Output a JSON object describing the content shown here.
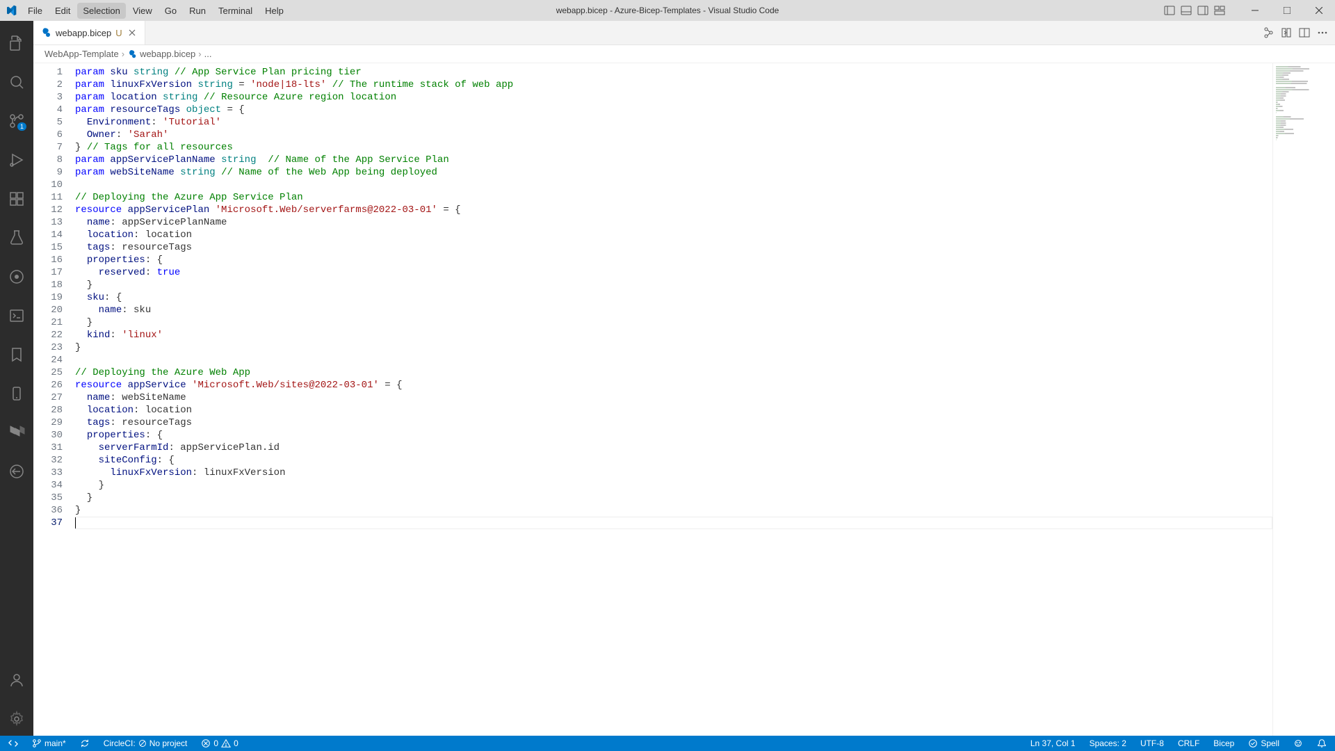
{
  "window": {
    "title": "webapp.bicep - Azure-Bicep-Templates - Visual Studio Code"
  },
  "menu": {
    "file": "File",
    "edit": "Edit",
    "selection": "Selection",
    "view": "View",
    "go": "Go",
    "run": "Run",
    "terminal": "Terminal",
    "help": "Help"
  },
  "activitybar": {
    "scm_badge": "1"
  },
  "tab": {
    "label": "webapp.bicep",
    "modified_marker": "U"
  },
  "breadcrumbs": {
    "root": "WebApp-Template",
    "file": "webapp.bicep",
    "trail": "..."
  },
  "code": {
    "lines": [
      {
        "n": 1,
        "tokens": [
          [
            "kw",
            "param"
          ],
          [
            "plain",
            " "
          ],
          [
            "ident",
            "sku"
          ],
          [
            "plain",
            " "
          ],
          [
            "type",
            "string"
          ],
          [
            "plain",
            " "
          ],
          [
            "com",
            "// App Service Plan pricing tier"
          ]
        ]
      },
      {
        "n": 2,
        "tokens": [
          [
            "kw",
            "param"
          ],
          [
            "plain",
            " "
          ],
          [
            "ident",
            "linuxFxVersion"
          ],
          [
            "plain",
            " "
          ],
          [
            "type",
            "string"
          ],
          [
            "plain",
            " = "
          ],
          [
            "str",
            "'node|18-lts'"
          ],
          [
            "plain",
            " "
          ],
          [
            "com",
            "// The runtime stack of web app"
          ]
        ]
      },
      {
        "n": 3,
        "tokens": [
          [
            "kw",
            "param"
          ],
          [
            "plain",
            " "
          ],
          [
            "ident",
            "location"
          ],
          [
            "plain",
            " "
          ],
          [
            "type",
            "string"
          ],
          [
            "plain",
            " "
          ],
          [
            "com",
            "// Resource Azure region location"
          ]
        ]
      },
      {
        "n": 4,
        "tokens": [
          [
            "kw",
            "param"
          ],
          [
            "plain",
            " "
          ],
          [
            "ident",
            "resourceTags"
          ],
          [
            "plain",
            " "
          ],
          [
            "type",
            "object"
          ],
          [
            "plain",
            " = {"
          ]
        ]
      },
      {
        "n": 5,
        "tokens": [
          [
            "plain",
            "  "
          ],
          [
            "prop",
            "Environment"
          ],
          [
            "plain",
            ": "
          ],
          [
            "str",
            "'Tutorial'"
          ]
        ]
      },
      {
        "n": 6,
        "tokens": [
          [
            "plain",
            "  "
          ],
          [
            "prop",
            "Owner"
          ],
          [
            "plain",
            ": "
          ],
          [
            "str",
            "'Sarah'"
          ]
        ]
      },
      {
        "n": 7,
        "tokens": [
          [
            "plain",
            "} "
          ],
          [
            "com",
            "// Tags for all resources"
          ]
        ]
      },
      {
        "n": 8,
        "tokens": [
          [
            "kw",
            "param"
          ],
          [
            "plain",
            " "
          ],
          [
            "ident",
            "appServicePlanName"
          ],
          [
            "plain",
            " "
          ],
          [
            "type",
            "string"
          ],
          [
            "plain",
            "  "
          ],
          [
            "com",
            "// Name of the App Service Plan"
          ]
        ]
      },
      {
        "n": 9,
        "tokens": [
          [
            "kw",
            "param"
          ],
          [
            "plain",
            " "
          ],
          [
            "ident",
            "webSiteName"
          ],
          [
            "plain",
            " "
          ],
          [
            "type",
            "string"
          ],
          [
            "plain",
            " "
          ],
          [
            "com",
            "// Name of the Web App being deployed"
          ]
        ]
      },
      {
        "n": 10,
        "tokens": [
          [
            "plain",
            ""
          ]
        ]
      },
      {
        "n": 11,
        "tokens": [
          [
            "com",
            "// Deploying the Azure App Service Plan"
          ]
        ]
      },
      {
        "n": 12,
        "tokens": [
          [
            "kw",
            "resource"
          ],
          [
            "plain",
            " "
          ],
          [
            "ident",
            "appServicePlan"
          ],
          [
            "plain",
            " "
          ],
          [
            "str",
            "'Microsoft.Web/serverfarms@2022-03-01'"
          ],
          [
            "plain",
            " = {"
          ]
        ]
      },
      {
        "n": 13,
        "tokens": [
          [
            "plain",
            "  "
          ],
          [
            "prop",
            "name"
          ],
          [
            "plain",
            ": appServicePlanName"
          ]
        ]
      },
      {
        "n": 14,
        "tokens": [
          [
            "plain",
            "  "
          ],
          [
            "prop",
            "location"
          ],
          [
            "plain",
            ": location"
          ]
        ]
      },
      {
        "n": 15,
        "tokens": [
          [
            "plain",
            "  "
          ],
          [
            "prop",
            "tags"
          ],
          [
            "plain",
            ": resourceTags"
          ]
        ]
      },
      {
        "n": 16,
        "tokens": [
          [
            "plain",
            "  "
          ],
          [
            "prop",
            "properties"
          ],
          [
            "plain",
            ": {"
          ]
        ]
      },
      {
        "n": 17,
        "tokens": [
          [
            "plain",
            "    "
          ],
          [
            "prop",
            "reserved"
          ],
          [
            "plain",
            ": "
          ],
          [
            "const",
            "true"
          ]
        ]
      },
      {
        "n": 18,
        "tokens": [
          [
            "plain",
            "  }"
          ]
        ]
      },
      {
        "n": 19,
        "tokens": [
          [
            "plain",
            "  "
          ],
          [
            "prop",
            "sku"
          ],
          [
            "plain",
            ": {"
          ]
        ]
      },
      {
        "n": 20,
        "tokens": [
          [
            "plain",
            "    "
          ],
          [
            "prop",
            "name"
          ],
          [
            "plain",
            ": sku"
          ]
        ]
      },
      {
        "n": 21,
        "tokens": [
          [
            "plain",
            "  }"
          ]
        ]
      },
      {
        "n": 22,
        "tokens": [
          [
            "plain",
            "  "
          ],
          [
            "prop",
            "kind"
          ],
          [
            "plain",
            ": "
          ],
          [
            "str",
            "'linux'"
          ]
        ]
      },
      {
        "n": 23,
        "tokens": [
          [
            "plain",
            "}"
          ]
        ]
      },
      {
        "n": 24,
        "tokens": [
          [
            "plain",
            ""
          ]
        ]
      },
      {
        "n": 25,
        "tokens": [
          [
            "com",
            "// Deploying the Azure Web App"
          ]
        ]
      },
      {
        "n": 26,
        "tokens": [
          [
            "kw",
            "resource"
          ],
          [
            "plain",
            " "
          ],
          [
            "ident",
            "appService"
          ],
          [
            "plain",
            " "
          ],
          [
            "str",
            "'Microsoft.Web/sites@2022-03-01'"
          ],
          [
            "plain",
            " = {"
          ]
        ]
      },
      {
        "n": 27,
        "tokens": [
          [
            "plain",
            "  "
          ],
          [
            "prop",
            "name"
          ],
          [
            "plain",
            ": webSiteName"
          ]
        ]
      },
      {
        "n": 28,
        "tokens": [
          [
            "plain",
            "  "
          ],
          [
            "prop",
            "location"
          ],
          [
            "plain",
            ": location"
          ]
        ]
      },
      {
        "n": 29,
        "tokens": [
          [
            "plain",
            "  "
          ],
          [
            "prop",
            "tags"
          ],
          [
            "plain",
            ": resourceTags"
          ]
        ]
      },
      {
        "n": 30,
        "tokens": [
          [
            "plain",
            "  "
          ],
          [
            "prop",
            "properties"
          ],
          [
            "plain",
            ": {"
          ]
        ]
      },
      {
        "n": 31,
        "tokens": [
          [
            "plain",
            "    "
          ],
          [
            "prop",
            "serverFarmId"
          ],
          [
            "plain",
            ": appServicePlan.id"
          ]
        ]
      },
      {
        "n": 32,
        "tokens": [
          [
            "plain",
            "    "
          ],
          [
            "prop",
            "siteConfig"
          ],
          [
            "plain",
            ": {"
          ]
        ]
      },
      {
        "n": 33,
        "tokens": [
          [
            "plain",
            "      "
          ],
          [
            "prop",
            "linuxFxVersion"
          ],
          [
            "plain",
            ": linuxFxVersion"
          ]
        ]
      },
      {
        "n": 34,
        "tokens": [
          [
            "plain",
            "    }"
          ]
        ]
      },
      {
        "n": 35,
        "tokens": [
          [
            "plain",
            "  }"
          ]
        ]
      },
      {
        "n": 36,
        "tokens": [
          [
            "plain",
            "}"
          ]
        ]
      },
      {
        "n": 37,
        "tokens": [
          [
            "plain",
            ""
          ]
        ],
        "active": true
      }
    ]
  },
  "statusbar": {
    "branch": "main*",
    "circleci_label": "CircleCI:",
    "circleci_status": "No project",
    "errors": "0",
    "warnings": "0",
    "cursor": "Ln 37, Col 1",
    "spaces": "Spaces: 2",
    "encoding": "UTF-8",
    "eol": "CRLF",
    "language": "Bicep",
    "spell": "Spell"
  }
}
